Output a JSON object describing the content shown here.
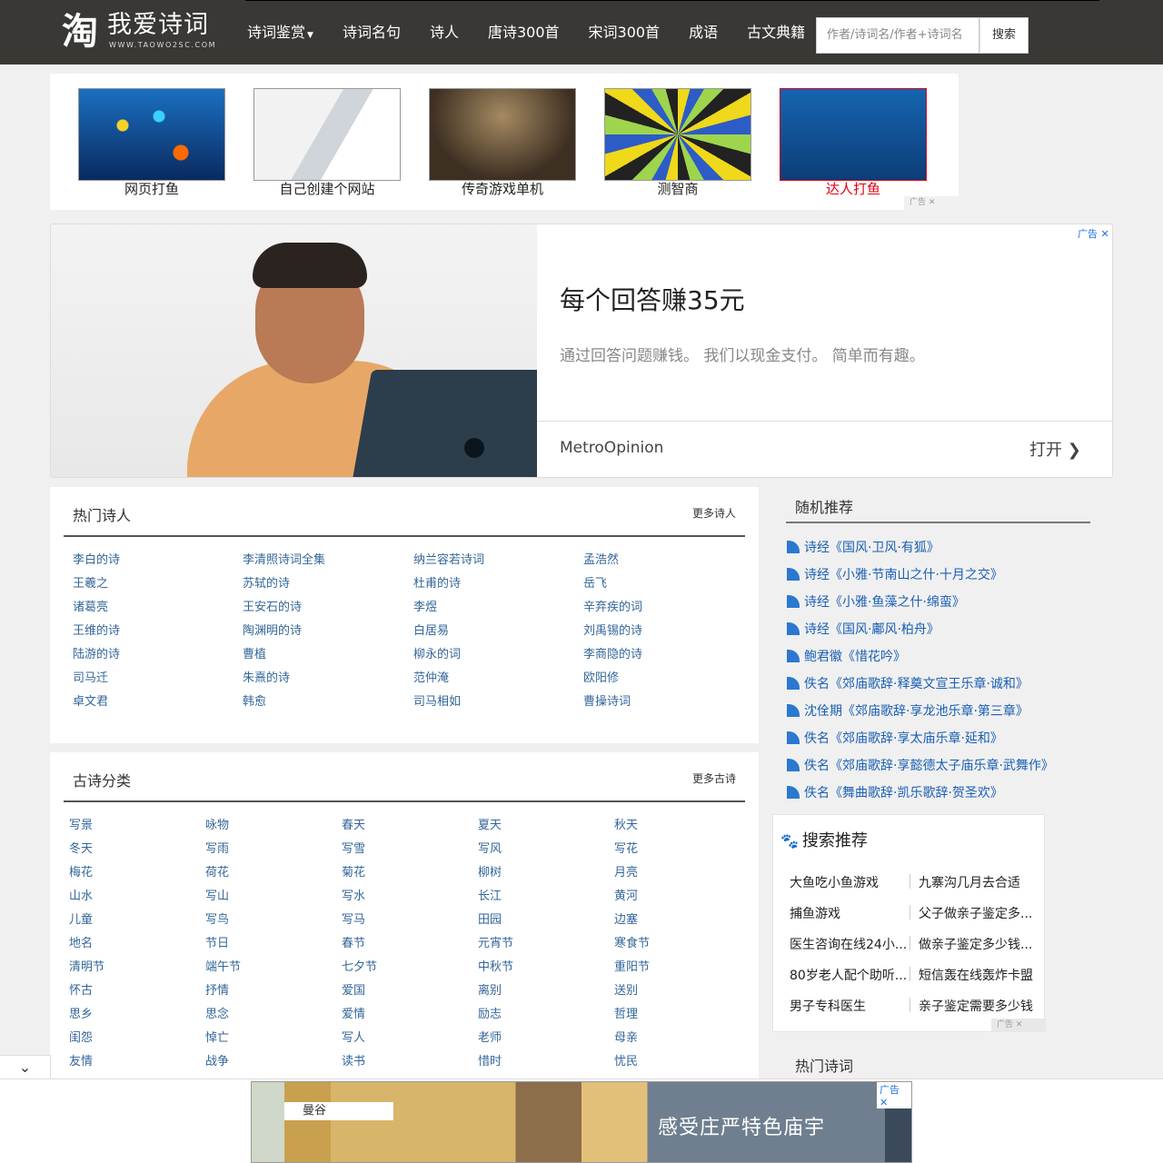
{
  "header": {
    "logo_glyph": "淘",
    "logo_title": "我爱诗词",
    "logo_sub": "WWW.TAOWO2SC.COM",
    "nav": [
      {
        "label": "诗词鉴赏",
        "caret": "▼"
      },
      {
        "label": "诗词名句"
      },
      {
        "label": "诗人"
      },
      {
        "label": "唐诗300首"
      },
      {
        "label": "宋词300首"
      },
      {
        "label": "成语"
      },
      {
        "label": "古文典籍"
      }
    ],
    "search_placeholder": "作者/诗词名/作者+诗词名",
    "search_button": "搜索"
  },
  "image_ads": {
    "items": [
      {
        "caption": "网页打鱼"
      },
      {
        "caption": "自己创建个网站"
      },
      {
        "caption": "传奇游戏单机"
      },
      {
        "caption": "测智商"
      },
      {
        "caption": "达人打鱼"
      }
    ],
    "tag": "广告 ✕"
  },
  "big_ad": {
    "title": "每个回答赚35元",
    "desc": "通过回答问题赚钱。 我们以现金支付。 简单而有趣。",
    "brand": "MetroOpinion",
    "open": "打开 ❯",
    "tag": "广告 ✕"
  },
  "hot_poets": {
    "title": "热门诗人",
    "more": "更多诗人",
    "columns": [
      [
        "李白的诗",
        "王羲之",
        "诸葛亮",
        "王维的诗",
        "陆游的诗",
        "司马迁",
        "卓文君"
      ],
      [
        "李清照诗词全集",
        "苏轼的诗",
        "王安石的诗",
        "陶渊明的诗",
        "曹植",
        "朱熹的诗",
        "韩愈"
      ],
      [
        "纳兰容若诗词",
        "杜甫的诗",
        "李煜",
        "白居易",
        "柳永的词",
        "范仲淹",
        "司马相如"
      ],
      [
        "孟浩然",
        "岳飞",
        "辛弃疾的词",
        "刘禹锡的诗",
        "李商隐的诗",
        "欧阳修",
        "曹操诗词"
      ]
    ]
  },
  "categories": {
    "title": "古诗分类",
    "more": "更多古诗",
    "columns": [
      [
        "写景",
        "冬天",
        "梅花",
        "山水",
        "儿童",
        "地名",
        "清明节",
        "怀古",
        "思乡",
        "闺怨",
        "友情"
      ],
      [
        "咏物",
        "写雨",
        "荷花",
        "写山",
        "写鸟",
        "节日",
        "端午节",
        "抒情",
        "思念",
        "悼亡",
        "战争"
      ],
      [
        "春天",
        "写雪",
        "菊花",
        "写水",
        "写马",
        "春节",
        "七夕节",
        "爱国",
        "爱情",
        "写人",
        "读书"
      ],
      [
        "夏天",
        "写风",
        "柳树",
        "长江",
        "田园",
        "元宵节",
        "中秋节",
        "离别",
        "励志",
        "老师",
        "惜时"
      ],
      [
        "秋天",
        "写花",
        "月亮",
        "黄河",
        "边塞",
        "寒食节",
        "重阳节",
        "送别",
        "哲理",
        "母亲",
        "忧民"
      ]
    ]
  },
  "random_rec": {
    "title": "随机推荐",
    "items": [
      "诗经《国风·卫风·有狐》",
      "诗经《小雅·节南山之什·十月之交》",
      "诗经《小雅·鱼藻之什·绵蛮》",
      "诗经《国风·鄘风·柏舟》",
      "鲍君徽《惜花吟》",
      "佚名《郊庙歌辞·释奠文宣王乐章·诚和》",
      "沈佺期《郊庙歌辞·享龙池乐章·第三章》",
      "佚名《郊庙歌辞·享太庙乐章·延和》",
      "佚名《郊庙歌辞·享懿德太子庙乐章·武舞作》",
      "佚名《舞曲歌辞·凯乐歌辞·贺圣欢》"
    ]
  },
  "search_rec": {
    "title": "搜索推荐",
    "paw": "🐾",
    "rows": [
      [
        "大鱼吃小鱼游戏",
        "九寨沟几月去合适"
      ],
      [
        "捕鱼游戏",
        "父子做亲子鉴定多..."
      ],
      [
        "医生咨询在线24小...",
        "做亲子鉴定多少钱..."
      ],
      [
        "80岁老人配个助听...",
        "短信轰在线轰炸卡盟"
      ],
      [
        "男子专科医生",
        "亲子鉴定需要多少钱"
      ]
    ],
    "tag": "广告 ✕"
  },
  "hot_poems": {
    "title": "热门诗词"
  },
  "bottom_ad": {
    "label": "曼谷",
    "text": "感受庄严特色庙宇",
    "tag": "广告 ✕"
  },
  "collapse": "⌄"
}
